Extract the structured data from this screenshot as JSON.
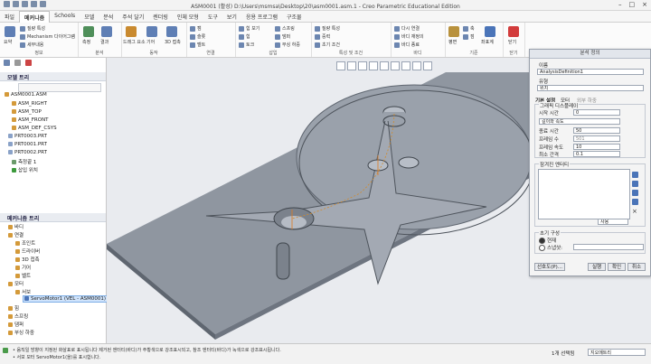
{
  "window": {
    "title": "ASM0001 (활성) D:\\Users\\msmsa\\Desktop\\20\\asm0001.asm.1 - Creo Parametric Educational Edition"
  },
  "tabs": [
    "파일",
    "메커니즘",
    "Schools",
    "모델",
    "분석",
    "주석 달기",
    "렌더링",
    "인체 모형",
    "도구",
    "보기",
    "응용 프로그램",
    "구조물"
  ],
  "ribbon": {
    "groups": [
      {
        "label": "정보",
        "items": [
          "요약",
          "질량 특성",
          "Mechanism 다이어그램",
          "세부내용"
        ]
      },
      {
        "label": "분석",
        "items": [
          "측정",
          "결과"
        ]
      },
      {
        "label": "동작",
        "items": [
          "드래그 요소",
          "기어",
          "3D 접촉"
        ]
      },
      {
        "label": "연결",
        "items": [
          "캠",
          "슬롯",
          "벨트"
        ]
      },
      {
        "label": "삽입",
        "items": [
          "힘 보기",
          "힘",
          "토크",
          "스프링",
          "댐퍼",
          "부싱 하중"
        ]
      },
      {
        "label": "특성 및 조건",
        "items": [
          "질량 특성",
          "중력",
          "초기 조건"
        ]
      },
      {
        "label": "바디",
        "items": [
          "다시 연결",
          "바디 재정의",
          "바디 종료"
        ]
      },
      {
        "label": "기준",
        "items": [
          "평면",
          "축",
          "점",
          "좌표계"
        ]
      },
      {
        "label": "닫기",
        "items": [
          "닫기"
        ]
      }
    ]
  },
  "model_tree": {
    "header": "모델 트리",
    "items": [
      "ASM0001.ASM",
      "ASM_RIGHT",
      "ASM_TOP",
      "ASM_FRONT",
      "ASM_DEF_CSYS",
      "PRT0003.PRT",
      "PRT0001.PRT",
      "PRT0002.PRT",
      "측정끝 1",
      "삽입 위치"
    ]
  },
  "mechanism_tree": {
    "header": "메커니즘 트리",
    "items": [
      "바디",
      "연결",
      "조인트",
      "드라이버",
      "3D 접촉",
      "기어",
      "벨트",
      "모터",
      "서보",
      "ServoMotor1 (VEL - ASM0001)",
      "힘",
      "스프링",
      "댐퍼",
      "부싱 하중"
    ]
  },
  "dialog": {
    "title": "분석 정의",
    "name_label": "이름",
    "name_value": "AnalysisDefinition1",
    "type_label": "유형",
    "type_value": "위치",
    "tabs": [
      "기본 설정",
      "모터",
      "외부 하중"
    ],
    "graph_display_label": "그래픽 디스플레이",
    "start_time_label": "시작 시간",
    "start_time_value": "0",
    "length_rate_value": "길이와 속도",
    "end_time_label": "종료 시간",
    "end_time_value": "50",
    "frame_count_label": "프레임 수",
    "frame_count_value": "501",
    "frame_rate_label": "프레임 속도",
    "frame_rate_value": "10",
    "min_interval_label": "최소 간격",
    "min_interval_value": "0.1",
    "locked_entity_label": "잠겨진 엔터티",
    "locked_entity_dropdown": "사용",
    "initial_config_label": "초기 구성",
    "option_current": "현재",
    "option_snapshot": "스냅샷:",
    "preferences_button": "선호도(P)...",
    "run_button": "실행",
    "ok_button": "확인",
    "cancel_button": "취소"
  },
  "status": {
    "messages": [
      "• 움직일 방향이 지정된 화살표로 표시됩니다 제거된 엔터티(바디)가 주황색으로 강조표시되고, 참조 엔터티(바디)가 녹색으로 강조표시됩니다.",
      "• 서보 모터 ServoMotor1(을)를 표시합니다."
    ],
    "selection_count": "1개 선택됨",
    "filter_value": "지오메트리"
  }
}
